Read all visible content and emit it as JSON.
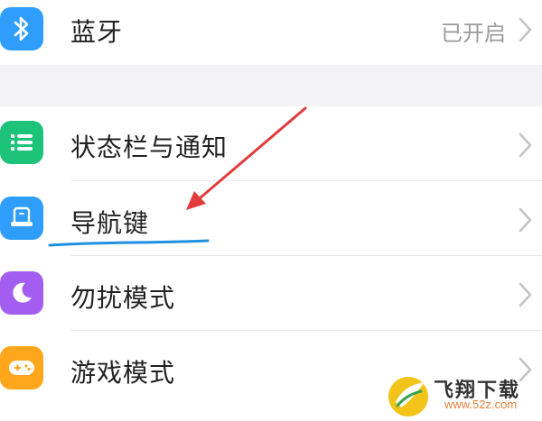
{
  "settings": {
    "items": [
      {
        "label": "蓝牙",
        "value": "已开启",
        "icon": "bluetooth-icon",
        "color": "#2e9dfc"
      },
      {
        "label": "状态栏与通知",
        "icon": "statusbar-notification-icon",
        "color": "#1ec37a"
      },
      {
        "label": "导航键",
        "icon": "navigation-key-icon",
        "color": "#2e9dfc"
      },
      {
        "label": "勿扰模式",
        "icon": "do-not-disturb-moon-icon",
        "color": "#a35ef1"
      },
      {
        "label": "游戏模式",
        "icon": "game-mode-icon",
        "color": "#ffa61d"
      }
    ]
  },
  "annotation": {
    "arrow_color": "#e23b3b",
    "underline_color": "#1f8fe0"
  },
  "watermark": {
    "name": "飞翔下载",
    "url": "www.52z.com"
  }
}
